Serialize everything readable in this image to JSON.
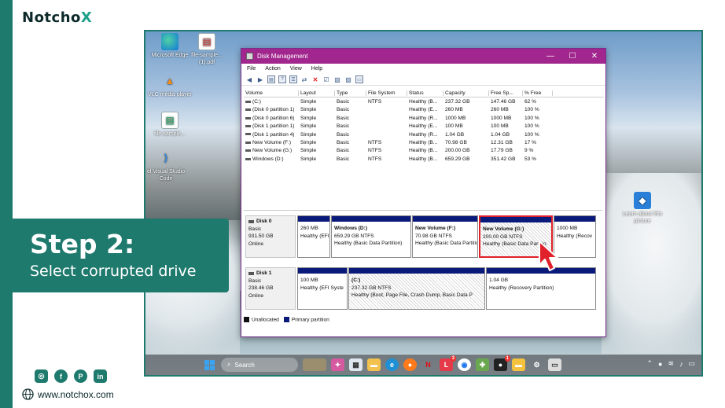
{
  "brand": {
    "logo_main": "Notcho",
    "logo_accent": "X"
  },
  "step": {
    "title": "Step 2:",
    "subtitle": "Select corrupted drive"
  },
  "social": [
    "instagram-icon",
    "facebook-icon",
    "pinterest-icon",
    "linkedin-icon"
  ],
  "website": "www.notchox.com",
  "colors": {
    "accent": "#1f7a6e",
    "title_bar": "#a1268d",
    "primary_partition": "#0a1a7a",
    "highlight": "#e0202a"
  },
  "desktop_icons": [
    {
      "icon": "edge-icon",
      "label": "Microsoft Edge"
    },
    {
      "icon": "pdf-file-icon",
      "label": "file-sample... (1).pdf"
    },
    {
      "icon": "vlc-icon",
      "label": "VLC media player"
    },
    {
      "icon": "file-icon",
      "label": "file-sample..."
    },
    {
      "icon": "visual-studio-code-icon",
      "label": "el Visual Studio Code"
    },
    {
      "icon": "learn-about-picture-icon",
      "label": "Learn about this picture"
    }
  ],
  "taskbar": {
    "search_label": "Search",
    "badges": [
      "3",
      "1"
    ]
  },
  "window": {
    "title": "Disk Management",
    "controls": {
      "minimize": "—",
      "maximize": "☐",
      "close": "✕"
    },
    "menu": [
      "File",
      "Action",
      "View",
      "Help"
    ],
    "columns": [
      "Volume",
      "Layout",
      "Type",
      "File System",
      "Status",
      "Capacity",
      "Free Sp...",
      "% Free"
    ],
    "volumes": [
      [
        "(C:)",
        "Simple",
        "Basic",
        "NTFS",
        "Healthy (B...",
        "237.32 GB",
        "147.46 GB",
        "62 %"
      ],
      [
        "(Disk 0 partition 1)",
        "Simple",
        "Basic",
        "",
        "Healthy (E...",
        "260 MB",
        "260 MB",
        "100 %"
      ],
      [
        "(Disk 0 partition 6)",
        "Simple",
        "Basic",
        "",
        "Healthy (R...",
        "1000 MB",
        "1000 MB",
        "100 %"
      ],
      [
        "(Disk 1 partition 1)",
        "Simple",
        "Basic",
        "",
        "Healthy (E...",
        "100 MB",
        "100 MB",
        "100 %"
      ],
      [
        "(Disk 1 partition 4)",
        "Simple",
        "Basic",
        "",
        "Healthy (R...",
        "1.04 GB",
        "1.04 GB",
        "100 %"
      ],
      [
        "New Volume (F:)",
        "Simple",
        "Basic",
        "NTFS",
        "Healthy (B...",
        "70.98 GB",
        "12.31 GB",
        "17 %"
      ],
      [
        "New Volume (G:)",
        "Simple",
        "Basic",
        "NTFS",
        "Healthy (B...",
        "200.00 GB",
        "17.79 GB",
        "9 %"
      ],
      [
        "Windows (D:)",
        "Simple",
        "Basic",
        "NTFS",
        "Healthy (B...",
        "659.29 GB",
        "351.42 GB",
        "53 %"
      ]
    ],
    "disks": [
      {
        "name": "Disk 0",
        "type": "Basic",
        "size": "931.50 GB",
        "status": "Online",
        "partitions": [
          {
            "name": "",
            "size": "260 MB",
            "status": "Healthy (EFI Sys"
          },
          {
            "name": "Windows  (D:)",
            "size": "659.29 GB NTFS",
            "status": "Healthy (Basic Data Partition)"
          },
          {
            "name": "New Volume  (F:)",
            "size": "70.98 GB NTFS",
            "status": "Healthy (Basic Data Partitio"
          },
          {
            "name": "New Volume  (G:)",
            "size": "200.00 GB NTFS",
            "status": "Healthy (Basic Data Partitio"
          },
          {
            "name": "",
            "size": "1000 MB",
            "status": "Healthy (Recov"
          }
        ]
      },
      {
        "name": "Disk 1",
        "type": "Basic",
        "size": "238.46 GB",
        "status": "Online",
        "partitions": [
          {
            "name": "",
            "size": "100 MB",
            "status": "Healthy (EFI Syste"
          },
          {
            "name": "(C:)",
            "size": "237.32 GB NTFS",
            "status": "Healthy (Boot, Page File, Crash Dump, Basic Data P"
          },
          {
            "name": "",
            "size": "1.04 GB",
            "status": "Healthy (Recovery Partition)"
          }
        ]
      }
    ],
    "legend": [
      "Unallocated",
      "Primary partition"
    ]
  }
}
